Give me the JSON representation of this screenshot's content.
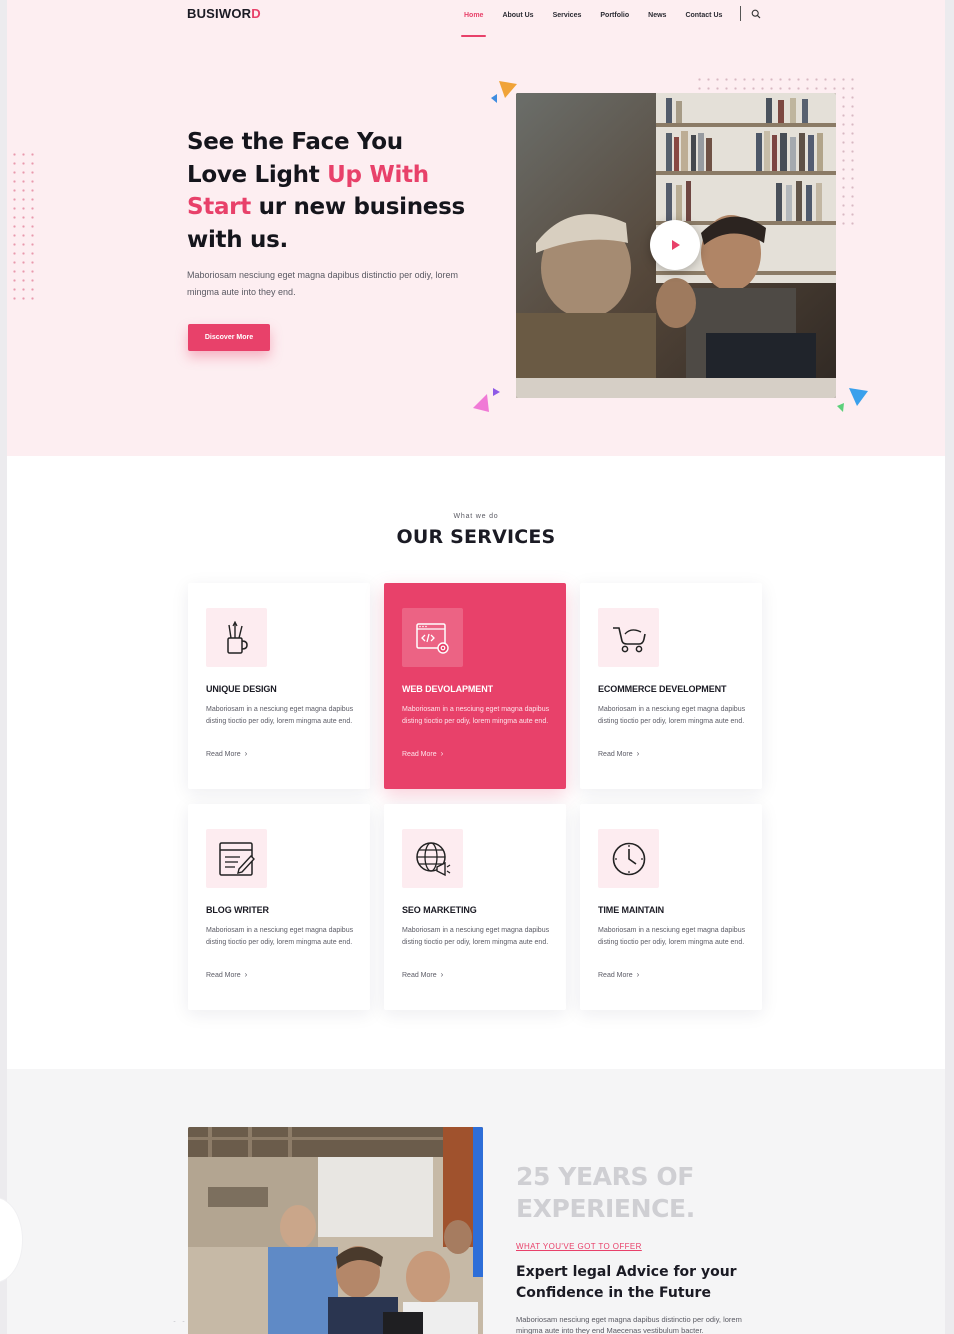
{
  "brand": {
    "name_main": "BUSIWOR",
    "name_accent": "D"
  },
  "nav": {
    "items": [
      "Home",
      "About Us",
      "Services",
      "Portfolio",
      "News",
      "Contact Us"
    ],
    "active": "Home"
  },
  "hero": {
    "line1": "See the Face You",
    "line2_a": "Love Light ",
    "line2_b": "Up With",
    "line3_a": "Start",
    "line3_b": " ur new business",
    "line4": "with us.",
    "description": "Maboriosam nesciung eget magna dapibus distinctio per odiy, lorem mingma aute into they end.",
    "cta": "Discover More"
  },
  "services": {
    "kicker": "What we do",
    "title": "OUR SERVICES",
    "cards": [
      {
        "icon": "pencil-cup-icon",
        "title": "UNIQUE DESIGN",
        "desc": "Maboriosam in a nesciung eget magna dapibus disting tioctio per odiy, lorem mingma aute end.",
        "more": "Read More",
        "active": false
      },
      {
        "icon": "code-window-icon",
        "title": "WEB DEVOLAPMENT",
        "desc": "Maboriosam in a nesciung eget magna dapibus disting tioctio per odiy, lorem mingma aute end.",
        "more": "Read More",
        "active": true
      },
      {
        "icon": "cart-icon",
        "title": "ECOMMERCE DEVELOPMENT",
        "desc": "Maboriosam in a nesciung eget magna dapibus disting tioctio per odiy, lorem mingma aute end.",
        "more": "Read More",
        "active": false
      },
      {
        "icon": "blog-edit-icon",
        "title": "BLOG WRITER",
        "desc": "Maboriosam in a nesciung eget magna dapibus disting tioctio per odiy, lorem mingma aute end.",
        "more": "Read More",
        "active": false
      },
      {
        "icon": "globe-megaphone-icon",
        "title": "SEO MARKETING",
        "desc": "Maboriosam in a nesciung eget magna dapibus disting tioctio per odiy, lorem mingma aute end.",
        "more": "Read More",
        "active": false
      },
      {
        "icon": "clock-icon",
        "title": "TIME MAINTAIN",
        "desc": "Maboriosam in a nesciung eget magna dapibus disting tioctio per odiy, lorem mingma aute end.",
        "more": "Read More",
        "active": false
      }
    ]
  },
  "experience": {
    "big_line1": "25 YEARS OF",
    "big_line2": "EXPERIENCE.",
    "kicker": "WHAT YOU'VE GOT TO OFFER",
    "heading_line1": "Expert legal Advice for your",
    "heading_line2": "Confidence in the Future",
    "description": "Maboriosam nesciung eget magna dapibus distinctio per odiy, lorem mingma aute into they end Maecenas vestibulum bacter."
  },
  "colors": {
    "accent": "#e8416a",
    "hero_bg": "#fdeef1",
    "text_dark": "#1b1b24"
  }
}
